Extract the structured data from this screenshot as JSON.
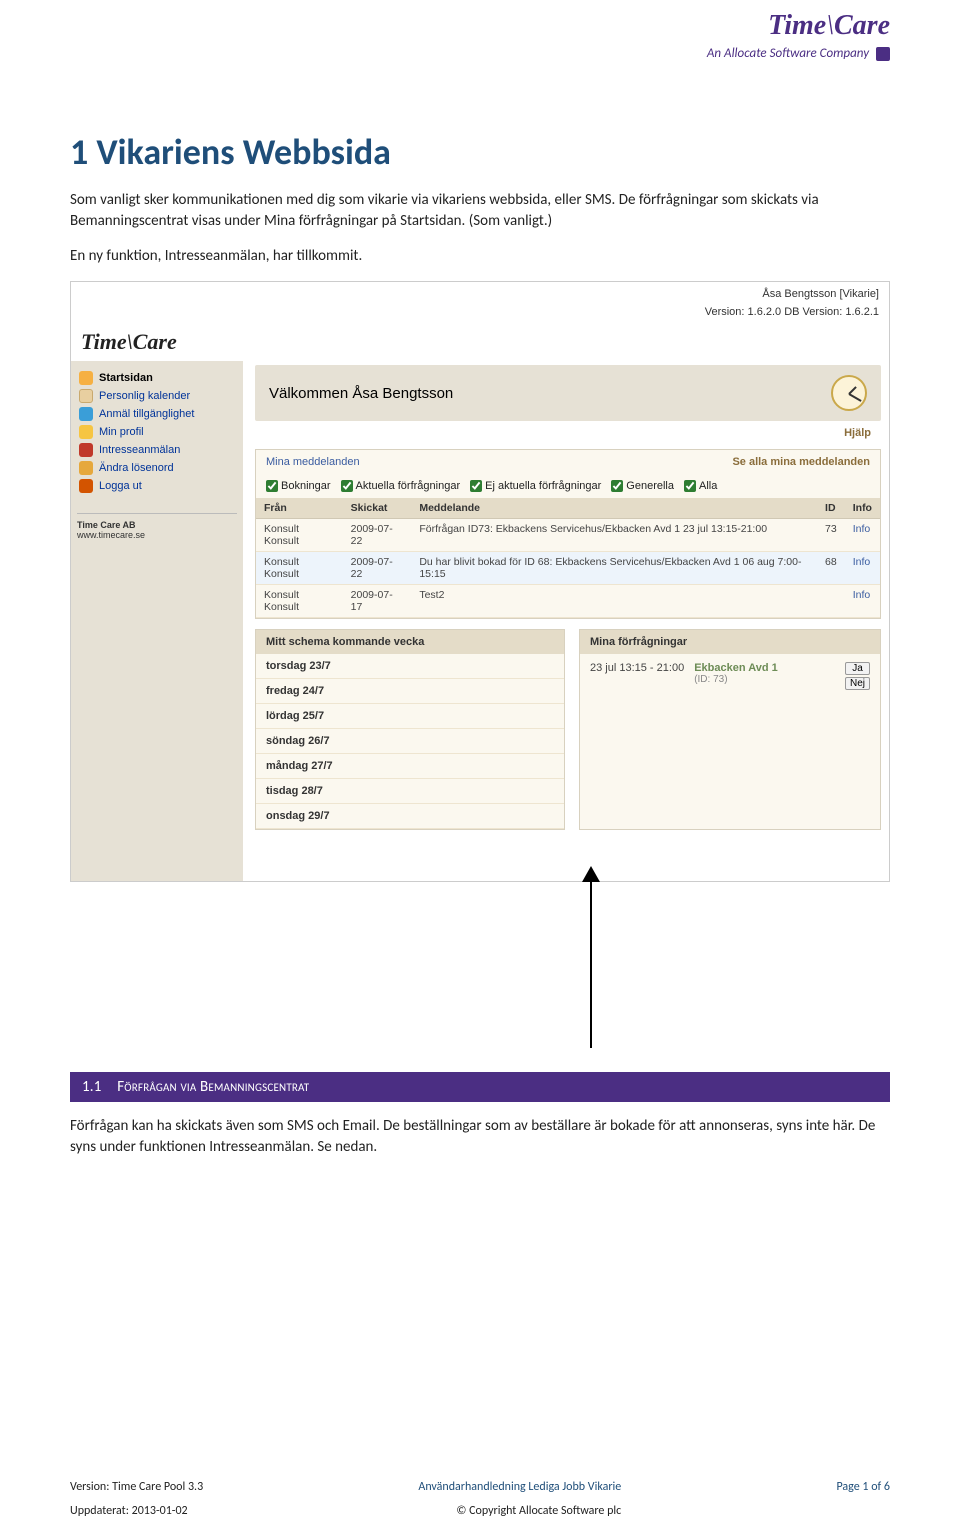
{
  "header_logo": {
    "main_left": "Time",
    "main_right": "Care",
    "sub": "An Allocate Software Company"
  },
  "doc": {
    "title": "1  Vikariens Webbsida",
    "p1": "Som vanligt sker kommunikationen med dig som vikarie via vikariens webbsida, eller SMS. De förfrågningar som skickats via Bemanningscentrat visas under Mina förfrågningar på Startsidan. (Som vanligt.)",
    "p2": "En ny funktion, Intresseanmälan, har tillkommit."
  },
  "screenshot": {
    "user": "Åsa Bengtsson [Vikarie]",
    "version": "Version: 1.6.2.0   DB Version: 1.6.2.1",
    "logo_left": "Time",
    "logo_right": "Care",
    "sidebar": {
      "items": [
        {
          "label": "Startsidan",
          "icon": "ic-start"
        },
        {
          "label": "Personlig kalender",
          "icon": "ic-cal"
        },
        {
          "label": "Anmäl tillgänglighet",
          "icon": "ic-avail"
        },
        {
          "label": "Min profil",
          "icon": "ic-profile"
        },
        {
          "label": "Intresseanmälan",
          "icon": "ic-interest"
        },
        {
          "label": "Ändra lösenord",
          "icon": "ic-pw"
        },
        {
          "label": "Logga ut",
          "icon": "ic-logout"
        }
      ],
      "company_name": "Time Care AB",
      "company_url": "www.timecare.se"
    },
    "welcome": "Välkommen Åsa Bengtsson",
    "help": "Hjälp",
    "messages": {
      "title": "Mina meddelanden",
      "all_link": "Se alla mina meddelanden",
      "filters": [
        "Bokningar",
        "Aktuella förfrågningar",
        "Ej aktuella förfrågningar",
        "Generella",
        "Alla"
      ],
      "columns": [
        "Från",
        "Skickat",
        "Meddelande",
        "ID",
        "Info"
      ],
      "rows": [
        {
          "from": "Konsult Konsult",
          "sent": "2009-07-22",
          "msg": "Förfrågan ID73: Ekbackens Servicehus/Ekbacken Avd 1 23 jul 13:15-21:00",
          "id": "73",
          "info": "Info"
        },
        {
          "from": "Konsult Konsult",
          "sent": "2009-07-22",
          "msg": "Du har blivit bokad för ID 68: Ekbackens Servicehus/Ekbacken Avd 1 06 aug 7:00-15:15",
          "id": "68",
          "info": "Info"
        },
        {
          "from": "Konsult Konsult",
          "sent": "2009-07-17",
          "msg": "Test2",
          "id": "",
          "info": "Info"
        }
      ]
    },
    "schedule": {
      "title": "Mitt schema kommande vecka",
      "days": [
        "torsdag 23/7",
        "fredag 24/7",
        "lördag 25/7",
        "söndag 26/7",
        "måndag 27/7",
        "tisdag 28/7",
        "onsdag 29/7"
      ]
    },
    "inquiries": {
      "title": "Mina förfrågningar",
      "time": "23 jul 13:15 - 21:00",
      "where": "Ekbacken Avd 1",
      "id_label": "(ID: 73)",
      "yes": "Ja",
      "no": "Nej"
    }
  },
  "section": {
    "num": "1.1",
    "title": "Förfrågan via Bemanningscentrat"
  },
  "body_after": "Förfrågan kan ha skickats även som SMS och Email. De beställningar som av beställare är bokade för att annonseras, syns inte här. De syns under funktionen Intresseanmälan. Se nedan.",
  "footer": {
    "version": "Version: Time Care Pool 3.3",
    "center": "Användarhandledning Lediga Jobb Vikarie",
    "page": "Page 1 of 6",
    "updated": "Uppdaterat: 2013-01-02",
    "copyright": "© Copyright Allocate Software plc"
  }
}
